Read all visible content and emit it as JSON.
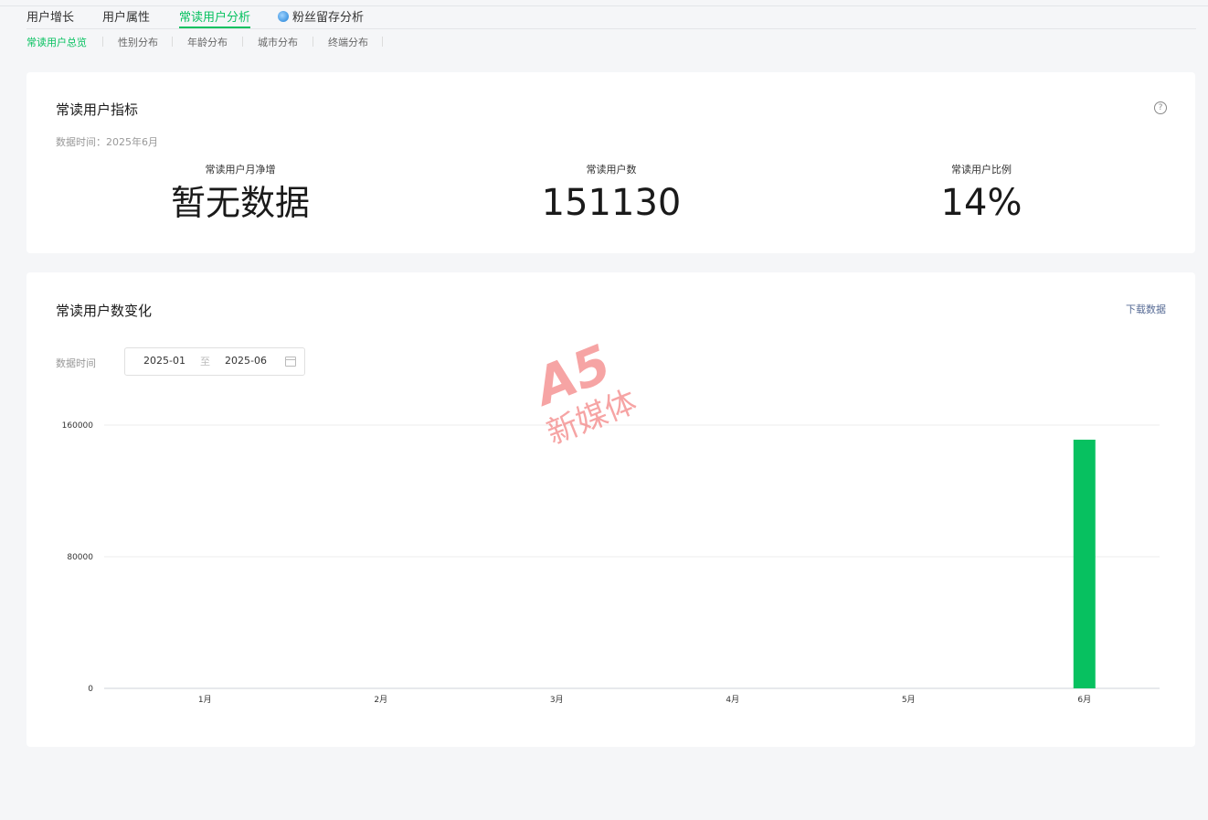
{
  "tabs": [
    {
      "label": "用户增长"
    },
    {
      "label": "用户属性"
    },
    {
      "label": "常读用户分析"
    },
    {
      "label": "粉丝留存分析"
    }
  ],
  "subtabs": [
    {
      "label": "常读用户总览"
    },
    {
      "label": "性别分布"
    },
    {
      "label": "年龄分布"
    },
    {
      "label": "城市分布"
    },
    {
      "label": "终端分布"
    }
  ],
  "indicators": {
    "title": "常读用户指标",
    "data_time": "数据时间：2025年6月",
    "metrics": [
      {
        "label": "常读用户月净增",
        "value": "暂无数据"
      },
      {
        "label": "常读用户数",
        "value": "151130"
      },
      {
        "label": "常读用户比例",
        "value": "14%"
      }
    ]
  },
  "trend": {
    "title": "常读用户数变化",
    "download_label": "下载数据",
    "data_time_label": "数据时间",
    "range_start": "2025-01",
    "range_sep": "至",
    "range_end": "2025-06"
  },
  "watermark": {
    "logo": "A5",
    "text": "新媒体"
  },
  "chart_data": {
    "type": "bar",
    "categories": [
      "1月",
      "2月",
      "3月",
      "4月",
      "5月",
      "6月"
    ],
    "series": [
      {
        "values": [
          0,
          0,
          0,
          0,
          0,
          151130
        ]
      }
    ],
    "y_ticks": [
      "0",
      "80000",
      "160000"
    ],
    "ylim": [
      0,
      160000
    ],
    "grid": true,
    "bar_color": "#07c160"
  },
  "colors": {
    "accent": "#07c160",
    "link": "#576b95"
  }
}
